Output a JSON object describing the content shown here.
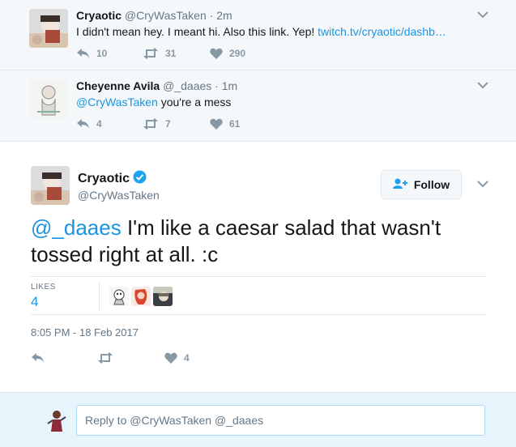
{
  "tweet1": {
    "name": "Cryaotic",
    "handle": "@CryWasTaken",
    "time": "· 2m",
    "text": "I didn't mean hey. I meant hi. Also this link. Yep!",
    "link": "twitch.tv/cryaotic/dashb…",
    "replies": "10",
    "retweets": "31",
    "likes": "290"
  },
  "tweet2": {
    "name": "Cheyenne Avila",
    "handle": "@_daaes",
    "time": "· 1m",
    "mention": "@CryWasTaken",
    "text": "you're a mess",
    "replies": "4",
    "retweets": "7",
    "likes": "61"
  },
  "main_tweet": {
    "name": "Cryaotic",
    "handle": "@CryWasTaken",
    "follow_label": "Follow",
    "mention": "@_daaes",
    "text": "I'm like a caesar salad that wasn't tossed right at all. :c",
    "likes_label": "LIKES",
    "likes_count": "4",
    "timestamp": "8:05 PM - 18 Feb 2017",
    "like_action_count": "4"
  },
  "reply": {
    "placeholder": "Reply to @CryWasTaken @_daaes"
  },
  "colors": {
    "link_blue": "#1b95e0",
    "verified_blue": "#1da1f2",
    "muted": "#8899a6"
  }
}
